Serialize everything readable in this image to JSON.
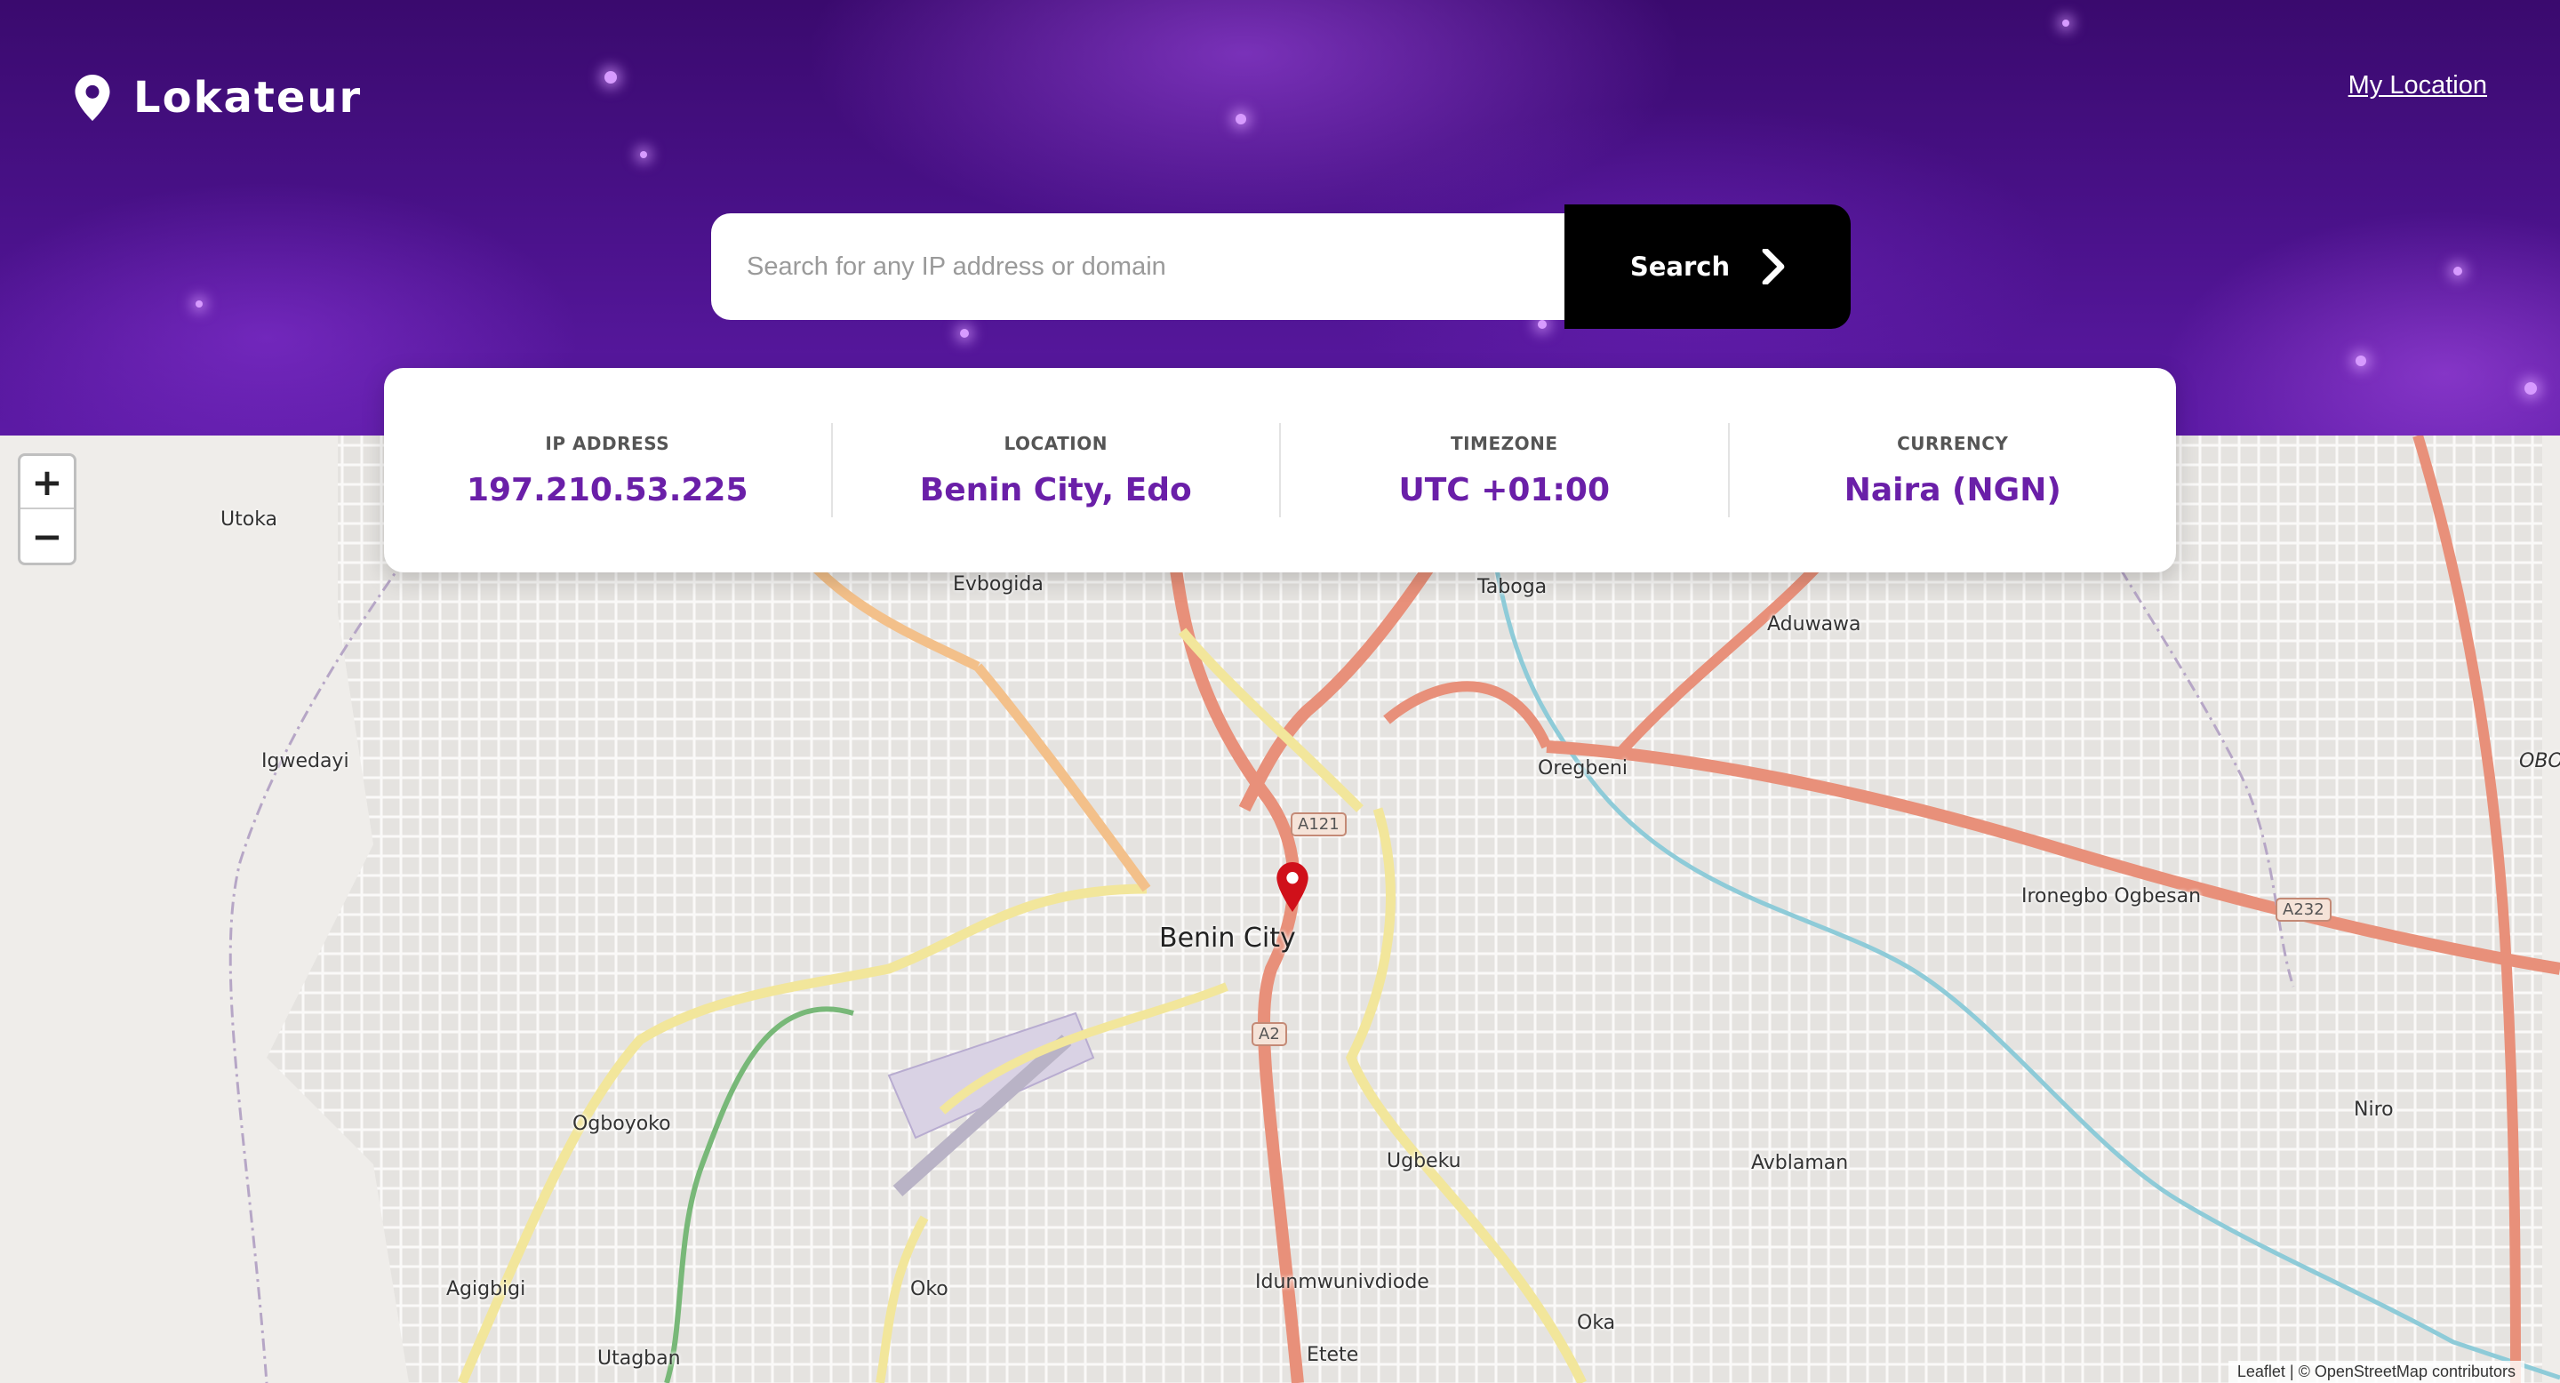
{
  "brand": {
    "name": "Lokateur",
    "icon": "map-pin-icon"
  },
  "nav": {
    "my_location": "My Location"
  },
  "search": {
    "placeholder": "Search for any IP address or domain",
    "value": "",
    "button_label": "Search",
    "button_icon": "chevron-right-icon"
  },
  "info": {
    "items": [
      {
        "label": "IP ADDRESS",
        "value": "197.210.53.225"
      },
      {
        "label": "LOCATION",
        "value": "Benin City, Edo"
      },
      {
        "label": "TIMEZONE",
        "value": "UTC +01:00"
      },
      {
        "label": "CURRENCY",
        "value": "Naira (NGN)"
      }
    ]
  },
  "map": {
    "zoom_in": "+",
    "zoom_out": "−",
    "places": [
      "Utoka",
      "Evbogida",
      "Taboga",
      "Aduwawa",
      "Igwedayi",
      "Oregbeni",
      "Benin City",
      "Ironegbo Ogbesan",
      "Ogboyoko",
      "Ugbeku",
      "Avblaman",
      "Niro",
      "Agigbigi",
      "Oko",
      "Idunmwunivdiode",
      "Oka",
      "Utagban",
      "Etete",
      "OBO"
    ],
    "road_tags": [
      "A121",
      "A2",
      "A232"
    ],
    "attribution": "Leaflet | © OpenStreetMap contributors"
  },
  "colors": {
    "accent": "#6a1fa8",
    "header": "#4b128c",
    "button": "#000000",
    "marker": "#d0101a"
  }
}
